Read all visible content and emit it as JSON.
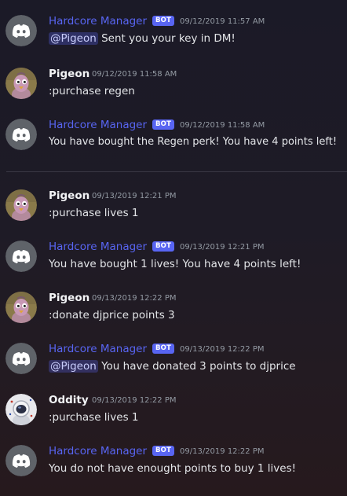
{
  "bot_tag": "BOT",
  "colors": {
    "bot_name": "#5865f2",
    "bot_tag_bg": "#5865f2",
    "mention_bg": "#3c4270",
    "timestamp": "#949ba4",
    "discord_avatar_bg": "#5f6369"
  },
  "messages": [
    {
      "author": "Hardcore Manager",
      "is_bot": true,
      "avatar": "discord-logo-icon",
      "timestamp": "09/12/2019 11:57 AM",
      "mention": "@Pigeon",
      "text": " Sent you your key in DM!"
    },
    {
      "author": "Pigeon",
      "is_bot": false,
      "avatar": "pigeon-avatar",
      "timestamp": "09/12/2019 11:58 AM",
      "text": ":purchase regen"
    },
    {
      "author": "Hardcore Manager",
      "is_bot": true,
      "avatar": "discord-logo-icon",
      "timestamp": "09/12/2019 11:58 AM",
      "text": "You have bought the Regen perk! You have 4 points left!"
    },
    {
      "author": "Pigeon",
      "is_bot": false,
      "avatar": "pigeon-avatar",
      "timestamp": "09/13/2019 12:21 PM",
      "text": ":purchase lives 1"
    },
    {
      "author": "Hardcore Manager",
      "is_bot": true,
      "avatar": "discord-logo-icon",
      "timestamp": "09/13/2019 12:21 PM",
      "text": "You have bought 1 lives! You have 4 points left!"
    },
    {
      "author": "Pigeon",
      "is_bot": false,
      "avatar": "pigeon-avatar",
      "timestamp": "09/13/2019 12:22 PM",
      "text": ":donate djprice points 3"
    },
    {
      "author": "Hardcore Manager",
      "is_bot": true,
      "avatar": "discord-logo-icon",
      "timestamp": "09/13/2019 12:22 PM",
      "mention": "@Pigeon",
      "text": " You have donated 3 points to djprice"
    },
    {
      "author": "Oddity",
      "is_bot": false,
      "avatar": "astronaut-avatar",
      "timestamp": "09/13/2019 12:22 PM",
      "text": ":purchase lives 1"
    },
    {
      "author": "Hardcore Manager",
      "is_bot": true,
      "avatar": "discord-logo-icon",
      "timestamp": "09/13/2019 12:22 PM",
      "text": "You do not have enought points to buy 1 lives!"
    }
  ]
}
